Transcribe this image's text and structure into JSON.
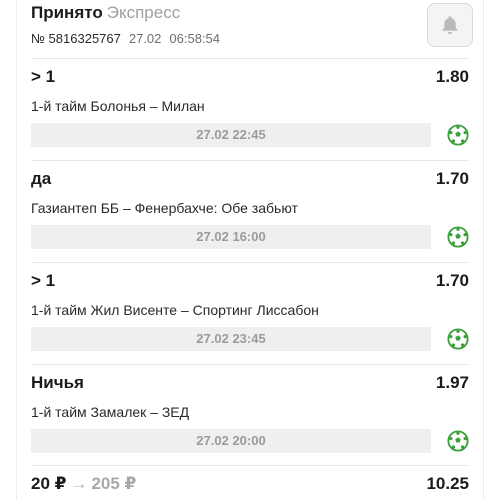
{
  "header": {
    "status": "Принято",
    "bet_type": "Экспресс",
    "bet_number": "№ 5816325767",
    "date": "27.02",
    "time": "06:58:54",
    "bell_icon": "bell-icon"
  },
  "bets": [
    {
      "outcome": "> 1",
      "odds": "1.80",
      "event": "1-й тайм Болонья – Милан",
      "start": "27.02 22:45",
      "sport_icon": "soccer-ball-icon"
    },
    {
      "outcome": "да",
      "odds": "1.70",
      "event": "Газиантеп ББ – Фенербахче: Обе забьют",
      "start": "27.02 16:00",
      "sport_icon": "soccer-ball-icon"
    },
    {
      "outcome": "> 1",
      "odds": "1.70",
      "event": "1-й тайм Жил Висенте – Спортинг Лиссабон",
      "start": "27.02 23:45",
      "sport_icon": "soccer-ball-icon"
    },
    {
      "outcome": "Ничья",
      "odds": "1.97",
      "event": "1-й тайм Замалек – ЗЕД",
      "start": "27.02 20:00",
      "sport_icon": "soccer-ball-icon"
    }
  ],
  "footer": {
    "stake": "20 ₽",
    "arrow": "→",
    "payout": "205 ₽",
    "total_odds": "10.25"
  },
  "colors": {
    "accent_green": "#3aa13a",
    "muted_gray": "#9b9b9b",
    "date_bar_bg": "#efefef"
  }
}
